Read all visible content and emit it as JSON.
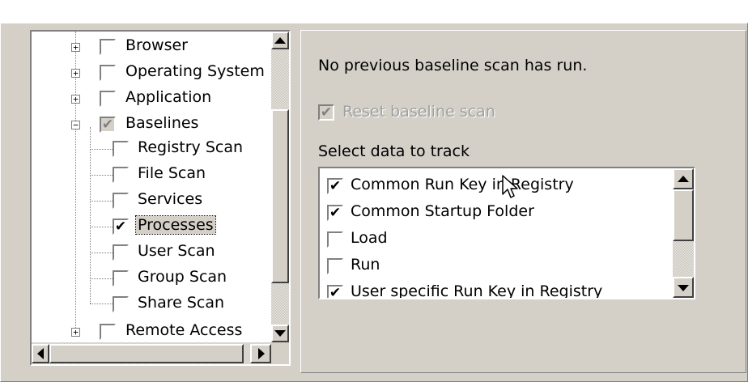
{
  "tree": {
    "items": [
      {
        "label": "Browser",
        "checked": false,
        "expander": "+"
      },
      {
        "label": "Operating System",
        "checked": false,
        "expander": "+"
      },
      {
        "label": "Application",
        "checked": false,
        "expander": "+"
      },
      {
        "label": "Baselines",
        "checked": true,
        "grayed": true,
        "expander": "−"
      },
      {
        "label": "Registry Scan",
        "checked": false
      },
      {
        "label": "File Scan",
        "checked": false
      },
      {
        "label": "Services",
        "checked": false
      },
      {
        "label": "Processes",
        "checked": true,
        "selected": true
      },
      {
        "label": "User Scan",
        "checked": false
      },
      {
        "label": "Group Scan",
        "checked": false
      },
      {
        "label": "Share Scan",
        "checked": false
      },
      {
        "label": "Remote Access",
        "checked": false,
        "expander": "+"
      }
    ]
  },
  "details": {
    "status_text": "No previous baseline scan has run.",
    "reset_label": "Reset baseline scan",
    "reset_checked": true,
    "reset_disabled": true,
    "select_label": "Select data to track",
    "track_items": [
      {
        "label": "Common Run Key in Registry",
        "checked": true
      },
      {
        "label": "Common Startup Folder",
        "checked": true
      },
      {
        "label": "Load",
        "checked": false
      },
      {
        "label": "Run",
        "checked": false
      },
      {
        "label": "User specific Run Key in Registry",
        "checked": true
      }
    ]
  },
  "glyphs": {
    "check": "✔",
    "cursor": "arrow-cursor"
  },
  "colors": {
    "face": "#d4d0c8",
    "shadow": "#808080",
    "highlight": "#ffffff",
    "disabled_text": "#a0a0a0"
  }
}
